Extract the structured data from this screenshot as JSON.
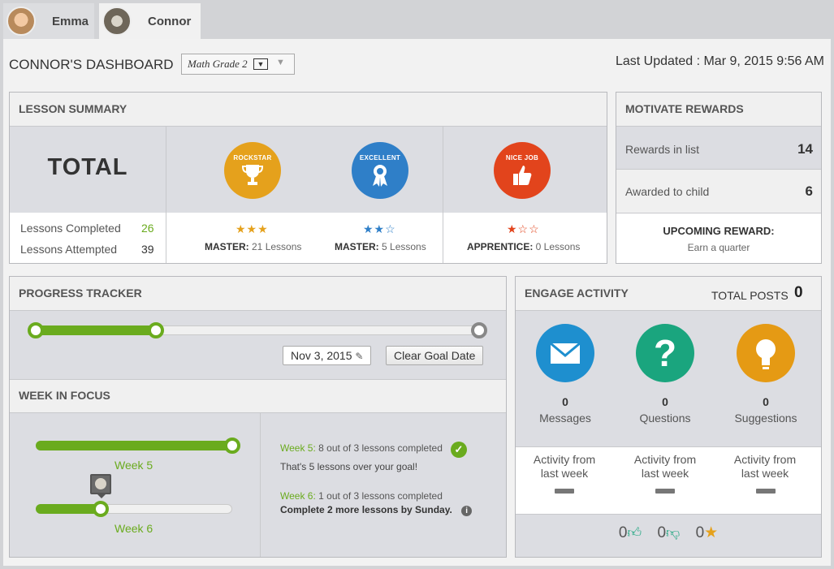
{
  "tabs": [
    {
      "name": "Emma"
    },
    {
      "name": "Connor"
    }
  ],
  "header": {
    "title": "CONNOR'S DASHBOARD",
    "subject": "Math Grade 2",
    "last_updated": "Last Updated : Mar 9, 2015 9:56 AM"
  },
  "lesson_summary": {
    "title": "LESSON SUMMARY",
    "total_label": "TOTAL",
    "completed_label": "Lessons Completed",
    "completed_value": "26",
    "attempted_label": "Lessons Attempted",
    "attempted_value": "39",
    "badges": [
      {
        "badge_text": "ROCKSTAR",
        "stars": "★★★",
        "level": "MASTER:",
        "lessons": " 21 Lessons",
        "color": "#e5a11c"
      },
      {
        "badge_text": "EXCELLENT",
        "stars": "★★☆",
        "level": "MASTER:",
        "lessons": " 5 Lessons",
        "color": "#2f7fc8"
      },
      {
        "badge_text": "NICE JOB",
        "stars": "★☆☆",
        "level": "APPRENTICE:",
        "lessons": " 0 Lessons",
        "color": "#e2441c"
      }
    ]
  },
  "rewards": {
    "title": "MOTIVATE REWARDS",
    "in_list_label": "Rewards in list",
    "in_list_value": "14",
    "awarded_label": "Awarded to child",
    "awarded_value": "6",
    "upcoming_label": "UPCOMING REWARD:",
    "upcoming_value": "Earn a quarter"
  },
  "progress": {
    "title": "PROGRESS TRACKER",
    "goal_date": "Nov 3, 2015",
    "clear_label": "Clear Goal Date",
    "fraction": 0.27
  },
  "week_focus": {
    "title": "WEEK IN FOCUS",
    "weeks": [
      {
        "label": "Week 5",
        "fraction": 1.0
      },
      {
        "label": "Week 6",
        "fraction": 0.33
      }
    ],
    "w5_label": "Week 5:",
    "w5_text": " 8 out of 3 lessons completed",
    "w5_note": "That's 5 lessons over your goal!",
    "w6_label": "Week 6:",
    "w6_text": " 1 out of 3 lessons completed",
    "w6_note": "Complete 2 more lessons by Sunday."
  },
  "engage": {
    "title": "ENGAGE ACTIVITY",
    "total_label": "TOTAL POSTS",
    "total_value": "0",
    "items": [
      {
        "value": "0",
        "label": "Messages",
        "color": "#1e8fcf",
        "activity": "Activity from last week"
      },
      {
        "value": "0",
        "label": "Questions",
        "color": "#1aa57e",
        "activity": "Activity from last week"
      },
      {
        "value": "0",
        "label": "Suggestions",
        "color": "#e59a14",
        "activity": "Activity from last week"
      }
    ],
    "thumbs_up": "0",
    "thumbs_down": "0",
    "stars": "0"
  }
}
